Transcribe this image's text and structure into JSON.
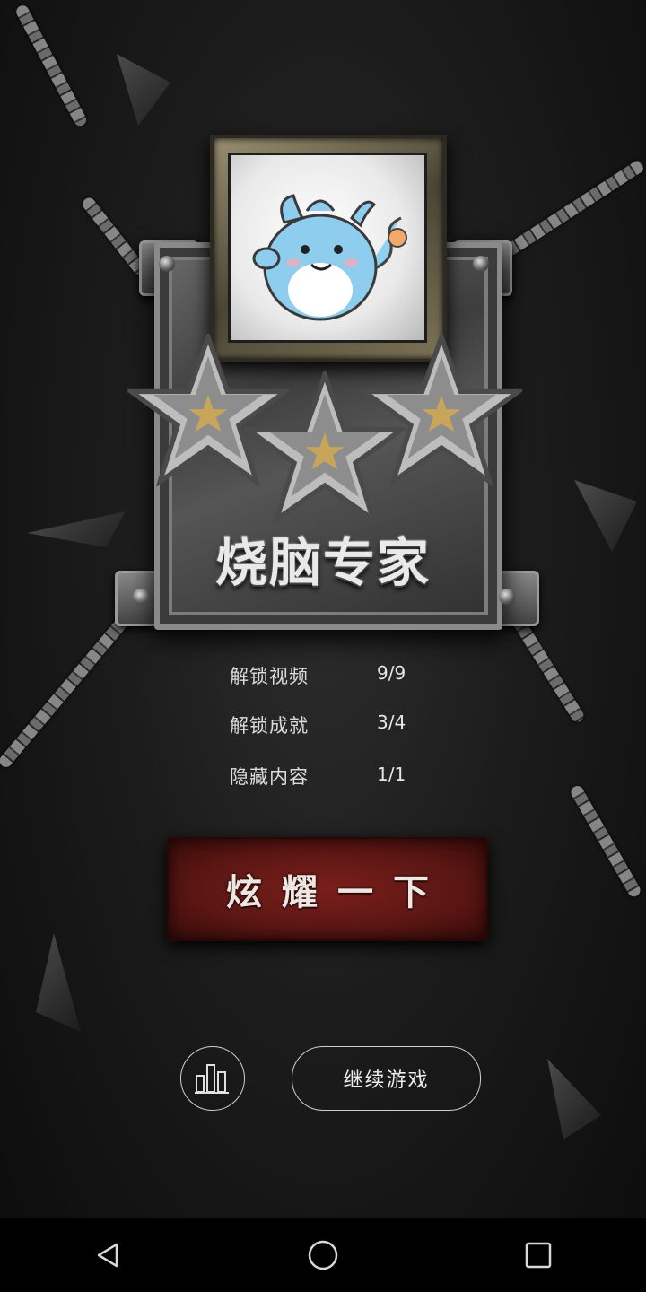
{
  "badge": {
    "title": "烧脑专家",
    "stars": 3,
    "mascot_icon": "blue-dragon-mascot"
  },
  "stats": [
    {
      "label": "解锁视频",
      "value": "9/9"
    },
    {
      "label": "解锁成就",
      "value": "3/4"
    },
    {
      "label": "隐藏内容",
      "value": "1/1"
    }
  ],
  "share_button": {
    "label": "炫耀一下"
  },
  "rank_button": {
    "icon": "bar-chart-icon"
  },
  "continue_button": {
    "label": "继续游戏"
  },
  "navbar": {
    "back_icon": "back-triangle-icon",
    "home_icon": "home-circle-icon",
    "recents_icon": "recents-square-icon"
  },
  "colors": {
    "background": "#1c1c1c",
    "share_button": "#6b1a17",
    "text": "#e8e8e8"
  }
}
